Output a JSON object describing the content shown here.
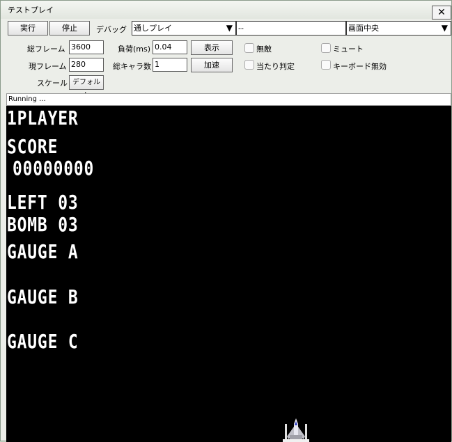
{
  "window": {
    "title": "テストプレイ",
    "close_glyph": "✕"
  },
  "toolbar": {
    "run_label": "実行",
    "stop_label": "停止",
    "debug_label": "デバッグ",
    "mode_select": "通しプレイ",
    "stage_select": "--",
    "view_select": "画面中央",
    "dropdown_glyph": "▼"
  },
  "settings": {
    "total_frames_label": "総フレーム",
    "total_frames_value": "3600",
    "current_frame_label": "現フレーム",
    "current_frame_value": "280",
    "load_label": "負荷(ms)",
    "load_value": "0.04",
    "total_chars_label": "総キャラ数",
    "total_chars_value": "1",
    "show_label": "表示",
    "speed_label": "加速",
    "scale_label": "スケール",
    "scale_button": "デフォルト",
    "invincible_label": "無敵",
    "hitbox_label": "当たり判定",
    "mute_label": "ミュート",
    "disable_keyboard_label": "キーボード無効"
  },
  "status": {
    "text": "Running ..."
  },
  "game": {
    "player": "1PLAYER",
    "score_label": "SCORE",
    "score_value": "00000000",
    "left": "LEFT 03",
    "bomb": "BOMB 03",
    "gauge_a": "GAUGE A",
    "gauge_b": "GAUGE B",
    "gauge_c": "GAUGE C"
  }
}
